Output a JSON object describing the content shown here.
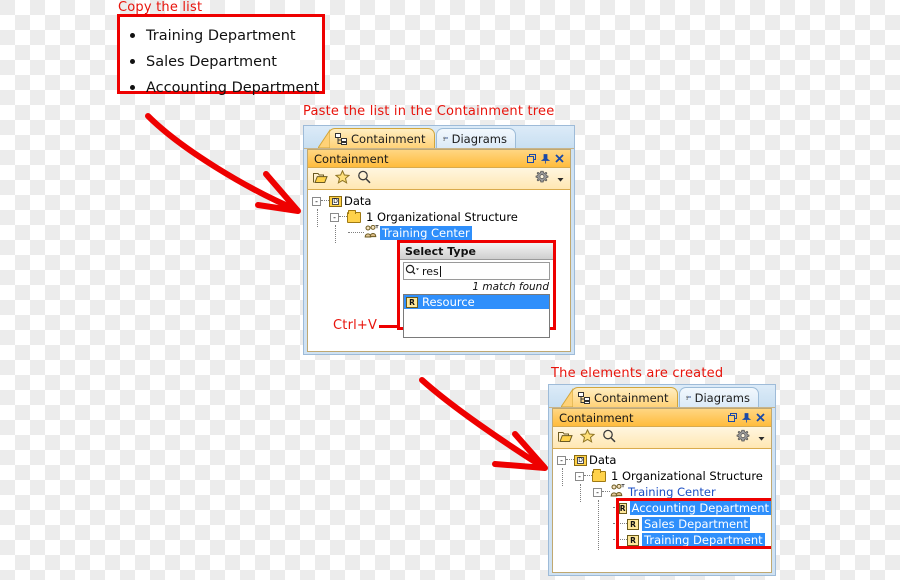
{
  "annotations": {
    "copy_list": "Copy the list",
    "paste_list": "Paste the list in the Containment tree",
    "elements_created": "The elements are created",
    "ctrl_v": "Ctrl+V"
  },
  "colors": {
    "annotation_red": "#e8140c",
    "box_red": "#ee0000",
    "selection_blue": "#2f8ffb",
    "title_orange": "#ffbc3d",
    "tab_blue": "#cfe2f3"
  },
  "source_list": {
    "items": [
      "Training Department",
      "Sales Department",
      "Accounting Department"
    ]
  },
  "panel_before": {
    "tabs": [
      {
        "label": "Containment",
        "icon": "containment-tree-icon",
        "active": true
      },
      {
        "label": "Diagrams",
        "icon": "diagrams-icon",
        "active": false
      }
    ],
    "title": "Containment",
    "title_buttons": [
      {
        "name": "restore-icon",
        "glyph": "❐"
      },
      {
        "name": "pin-icon",
        "glyph": "↧"
      },
      {
        "name": "close-icon",
        "glyph": "✕"
      }
    ],
    "toolbar": [
      {
        "name": "open-folder-icon",
        "glyph": "📂"
      },
      {
        "name": "favorites-star-icon",
        "glyph": "☆"
      },
      {
        "name": "search-icon",
        "glyph": "⚲"
      },
      {
        "name": "gear-icon",
        "glyph": "⚙"
      },
      {
        "name": "chevron-down-icon",
        "glyph": "▾"
      }
    ],
    "tree": [
      {
        "label": "Data",
        "icon": "data-icon",
        "depth": 0,
        "expander": "-",
        "selected": false
      },
      {
        "label": "1 Organizational Structure",
        "icon": "folder-icon",
        "depth": 1,
        "expander": "-",
        "selected": false
      },
      {
        "label": "Training Center",
        "icon": "actors-icon",
        "depth": 2,
        "expander": "",
        "selected": true
      }
    ]
  },
  "select_type_popup": {
    "title": "Select Type",
    "search_value": "res",
    "search_icon": "search-dropdown-icon",
    "match_text": "1 match found",
    "options": [
      {
        "label": "Resource",
        "icon": "R",
        "selected": true
      }
    ]
  },
  "panel_after": {
    "tabs": [
      {
        "label": "Containment",
        "icon": "containment-tree-icon",
        "active": true
      },
      {
        "label": "Diagrams",
        "icon": "diagrams-icon",
        "active": false
      }
    ],
    "title": "Containment",
    "title_buttons": [
      {
        "name": "restore-icon",
        "glyph": "❐"
      },
      {
        "name": "pin-icon",
        "glyph": "↧"
      },
      {
        "name": "close-icon",
        "glyph": "✕"
      }
    ],
    "toolbar": [
      {
        "name": "open-folder-icon",
        "glyph": "📂"
      },
      {
        "name": "favorites-star-icon",
        "glyph": "☆"
      },
      {
        "name": "search-icon",
        "glyph": "⚲"
      },
      {
        "name": "gear-icon",
        "glyph": "⚙"
      },
      {
        "name": "chevron-down-icon",
        "glyph": "▾"
      }
    ],
    "tree": [
      {
        "label": "Data",
        "icon": "data-icon",
        "depth": 0,
        "expander": "-"
      },
      {
        "label": "1 Organizational Structure",
        "icon": "folder-icon",
        "depth": 1,
        "expander": "-"
      },
      {
        "label": "Training Center",
        "icon": "actors-icon",
        "depth": 2,
        "expander": "-"
      }
    ],
    "created_items": [
      {
        "label": "Accounting Department",
        "icon": "R",
        "selected": true
      },
      {
        "label": "Sales Department",
        "icon": "R",
        "selected": true
      },
      {
        "label": "Training Department",
        "icon": "R",
        "selected": true
      }
    ]
  }
}
